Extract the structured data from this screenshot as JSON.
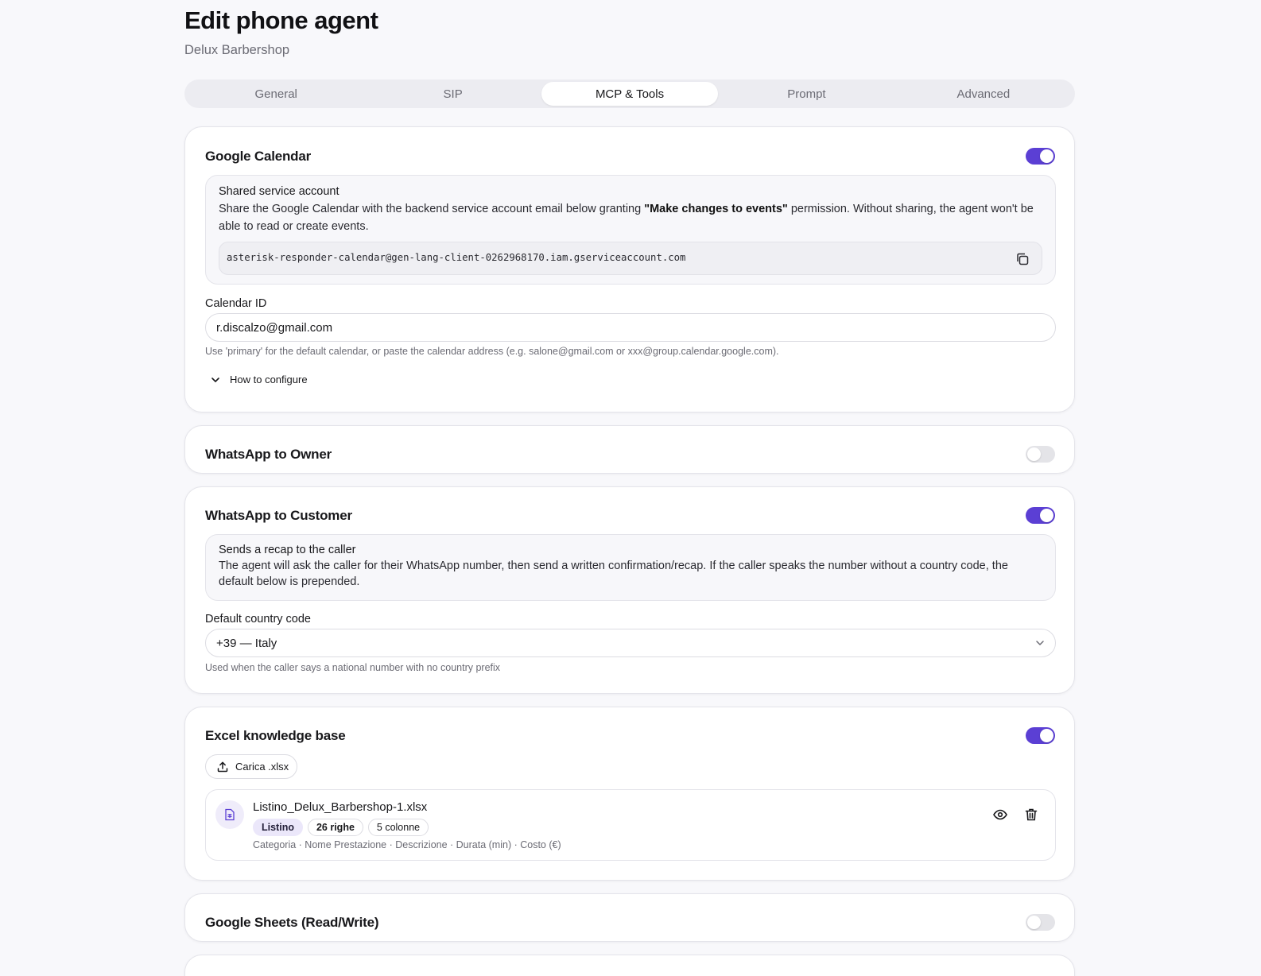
{
  "header": {
    "title": "Edit phone agent",
    "subtitle": "Delux Barbershop"
  },
  "tabs": [
    {
      "label": "General",
      "active": false
    },
    {
      "label": "SIP",
      "active": false
    },
    {
      "label": "MCP & Tools",
      "active": true
    },
    {
      "label": "Prompt",
      "active": false
    },
    {
      "label": "Advanced",
      "active": false
    }
  ],
  "colors": {
    "accent": "#5b3fd4",
    "toggle_off": "#e4e4e8"
  },
  "google_calendar": {
    "title": "Google Calendar",
    "enabled": true,
    "info_title": "Shared service account",
    "info_text_before": "Share the Google Calendar with the backend service account email below granting ",
    "info_text_bold": "\"Make changes to events\"",
    "info_text_after": " permission. Without sharing, the agent won't be able to read or create events.",
    "service_email": "asterisk-responder-calendar@gen-lang-client-0262968170.iam.gserviceaccount.com",
    "copy_icon": "copy-icon",
    "calendar_id_label": "Calendar ID",
    "calendar_id_value": "r.discalzo@gmail.com",
    "calendar_id_hint": "Use 'primary' for the default calendar, or paste the calendar address (e.g. salone@gmail.com or xxx@group.calendar.google.com).",
    "how_to_label": "How to configure"
  },
  "whatsapp_owner": {
    "title": "WhatsApp to Owner",
    "enabled": false
  },
  "whatsapp_customer": {
    "title": "WhatsApp to Customer",
    "enabled": true,
    "info_title": "Sends a recap to the caller",
    "info_text": "The agent will ask the caller for their WhatsApp number, then send a written confirmation/recap. If the caller speaks the number without a country code, the default below is prepended.",
    "country_label": "Default country code",
    "country_value": "+39 — Italy",
    "country_hint": "Used when the caller says a national number with no country prefix"
  },
  "excel_kb": {
    "title": "Excel knowledge base",
    "enabled": true,
    "upload_label": "Carica .xlsx",
    "file": {
      "name": "Listino_Delux_Barbershop-1.xlsx",
      "badges": [
        "Listino",
        "26 righe",
        "5 colonne"
      ],
      "columns": "Categoria · Nome Prestazione · Descrizione · Durata (min) · Costo (€)"
    }
  },
  "google_sheets": {
    "title": "Google Sheets (Read/Write)",
    "enabled": false
  }
}
